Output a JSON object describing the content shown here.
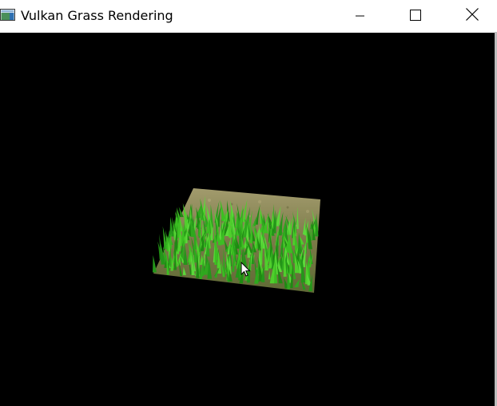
{
  "window": {
    "title": "Vulkan Grass Rendering",
    "icon": "app-window-icon",
    "controls": {
      "minimize_icon": "minimize-icon",
      "maximize_icon": "maximize-icon",
      "close_icon": "close-icon"
    }
  },
  "viewport": {
    "background": "#000000",
    "scene": {
      "ground_color": "#8c8a5a",
      "grass_color": "#2fa81e",
      "cursor_icon": "mouse-pointer-icon"
    }
  }
}
